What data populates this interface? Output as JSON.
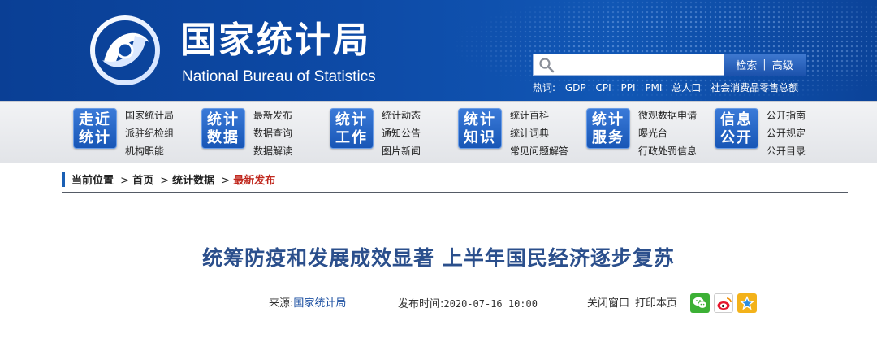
{
  "header": {
    "title_cn": "国家统计局",
    "title_en": "National Bureau of Statistics",
    "search": {
      "placeholder": "",
      "search_label": "检索",
      "separator": "|",
      "advanced_label": "高级"
    },
    "hot_words": [
      "热词:",
      "GDP",
      "CPI",
      "PPI",
      "PMI",
      "总人口",
      "社会消费品零售总额"
    ],
    "colors": {
      "header_bg": "#0d4aa6",
      "badge": "#2a68c8"
    }
  },
  "nav": [
    {
      "badge": [
        "走近",
        "统计"
      ],
      "links": [
        "国家统计局",
        "派驻纪检组",
        "机构职能"
      ]
    },
    {
      "badge": [
        "统计",
        "数据"
      ],
      "links": [
        "最新发布",
        "数据查询",
        "数据解读"
      ]
    },
    {
      "badge": [
        "统计",
        "工作"
      ],
      "links": [
        "统计动态",
        "通知公告",
        "图片新闻"
      ]
    },
    {
      "badge": [
        "统计",
        "知识"
      ],
      "links": [
        "统计百科",
        "统计词典",
        "常见问题解答"
      ]
    },
    {
      "badge": [
        "统计",
        "服务"
      ],
      "links": [
        "微观数据申请",
        "曝光台",
        "行政处罚信息"
      ]
    },
    {
      "badge": [
        "信息",
        "公开"
      ],
      "links": [
        "公开指南",
        "公开规定",
        "公开目录"
      ]
    }
  ],
  "breadcrumb": {
    "label": "当前位置",
    "arrow": ">",
    "items": [
      "首页",
      "统计数据"
    ],
    "current": "最新发布"
  },
  "article": {
    "title": "统筹防疫和发展成效显著  上半年国民经济逐步复苏",
    "source_label": "来源:",
    "source_value": "国家统计局",
    "time_label": "发布时间:",
    "time_value": "2020-07-16 10:00",
    "close_window": "关闭窗口",
    "print_page": "打印本页",
    "share_icons": [
      "wechat-icon",
      "weibo-icon",
      "qzone-icon"
    ]
  }
}
